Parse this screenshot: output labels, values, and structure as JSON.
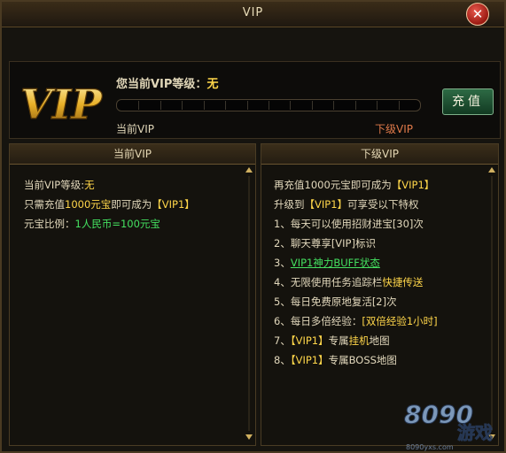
{
  "window": {
    "title": "VIP"
  },
  "top": {
    "logo_text": "VIP",
    "level_label": "您当前VIP等级：",
    "level_value": "无",
    "recharge_label": "充值",
    "current_vip_label": "当前VIP",
    "next_vip_label": "下级VIP",
    "progress": 0
  },
  "left_panel": {
    "title": "当前VIP",
    "l1_prefix": "当前VIP等级:",
    "l1_value": "无",
    "l2_a": "只需充值",
    "l2_b": "1000元宝",
    "l2_c": "即可成为",
    "l2_d": "【VIP1】",
    "l3_a": "元宝比例：",
    "l3_b": "1人民币=100元宝"
  },
  "right_panel": {
    "title": "下级VIP",
    "r1_a": "再充值1000元宝即可成为",
    "r1_b": "【VIP1】",
    "r2_a": "升级到",
    "r2_b": "【VIP1】",
    "r2_c": "可享受以下特权",
    "r3": "1、每天可以使用招财进宝[30]次",
    "r4": "2、聊天尊享[VIP]标识",
    "r5_a": "3、",
    "r5_b": "VIP1神力BUFF状态",
    "r6_a": "4、无限使用任务追踪栏",
    "r6_b": "快捷传送",
    "r7": "5、每日免费原地复活[2]次",
    "r8_a": "6、每日多倍经验：",
    "r8_b": "[双倍经验1小时]",
    "r9_a": "7、",
    "r9_b": "【VIP1】",
    "r9_c": "专属",
    "r9_d": "挂机",
    "r9_e": "地图",
    "r10_a": "8、",
    "r10_b": "【VIP1】",
    "r10_c": "专属BOSS地图"
  },
  "watermark": {
    "text": "8090",
    "sub": "游戏",
    "url": "8090yxs.com"
  },
  "colors": {
    "accent_gold": "#ffd64a",
    "link_green": "#44e060",
    "next_orange": "#e07a4a"
  }
}
